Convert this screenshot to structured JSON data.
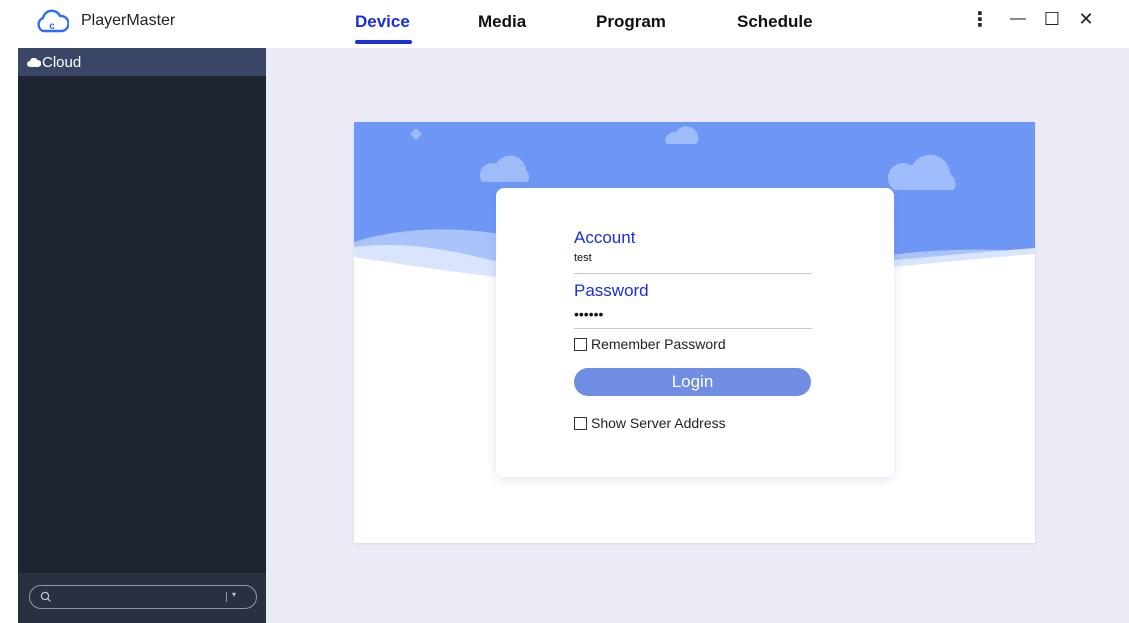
{
  "app": {
    "name": "PlayerMaster",
    "logo_icon": "cloud-logo-icon"
  },
  "nav": {
    "tabs": [
      {
        "label": "Device",
        "active": true
      },
      {
        "label": "Media",
        "active": false
      },
      {
        "label": "Program",
        "active": false
      },
      {
        "label": "Schedule",
        "active": false
      }
    ]
  },
  "window_controls": {
    "more_icon": "⋮",
    "minimize_icon": "—",
    "maximize_icon": "☐",
    "close_icon": "✕"
  },
  "sidebar": {
    "header_label": "Cloud",
    "search": {
      "placeholder": "",
      "value": "",
      "dropdown_icon": "▾"
    }
  },
  "login": {
    "account_label": "Account",
    "account_value": "test",
    "password_label": "Password",
    "password_value": "••••••",
    "remember_label": "Remember Password",
    "login_button": "Login",
    "show_server_label": "Show Server Address"
  },
  "colors": {
    "accent": "#1a2fd6",
    "sidebar_bg": "#1f2432",
    "sidebar_header_bg": "#3a4666",
    "main_bg": "#ebebf6",
    "banner_blue": "#6e97f5",
    "login_button": "#6e8de3"
  }
}
